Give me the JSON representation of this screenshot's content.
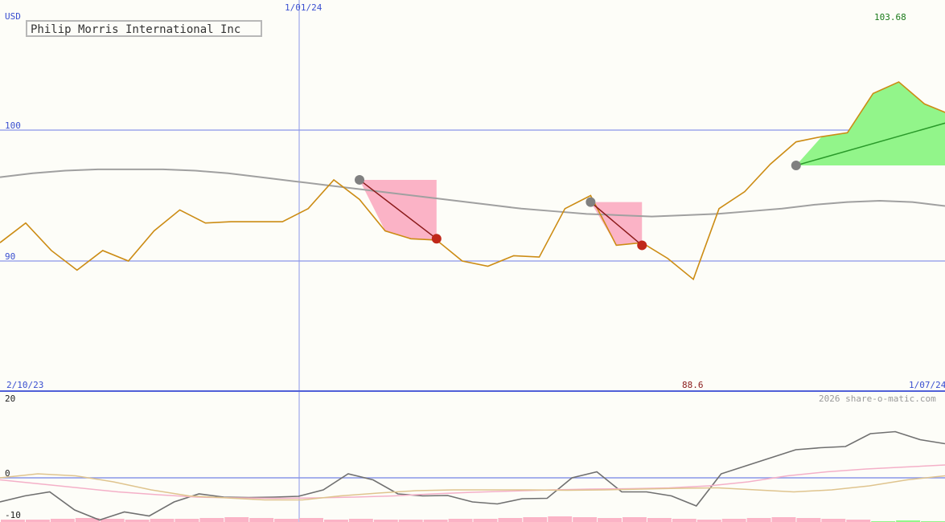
{
  "chart_data": [
    {
      "type": "line",
      "title": "Philip Morris International Inc",
      "currency_label": "USD",
      "y_ticks": [
        100,
        90
      ],
      "ylim": [
        80.3,
        109.6
      ],
      "x_date_labels": {
        "start": "2/10/23",
        "marker": "1/01/24",
        "end": "1/07/24"
      },
      "max_label": "103.68",
      "min_label": "88.6",
      "watermark": "2026 share-o-matic.com",
      "series": [
        {
          "values": [
            91.4,
            92.9,
            90.8,
            89.3,
            90.8,
            90.0,
            92.3,
            93.9,
            92.9,
            93.0,
            93.0,
            93.0,
            94.0,
            96.2,
            94.7,
            92.3,
            91.7,
            91.6,
            90.0,
            89.6,
            90.4,
            90.3,
            94.0,
            95.0,
            91.2,
            91.4,
            90.2,
            88.6,
            94.0,
            95.3,
            97.4,
            99.1,
            99.5,
            99.8,
            102.8,
            103.68,
            102.0,
            101.2
          ]
        },
        {
          "values": [
            96.4,
            96.7,
            96.9,
            97.0,
            97.0,
            97.0,
            96.9,
            96.7,
            96.4,
            96.1,
            95.8,
            95.5,
            95.2,
            94.9,
            94.6,
            94.3,
            94.0,
            93.8,
            93.6,
            93.5,
            93.4,
            93.5,
            93.6,
            93.8,
            94.0,
            94.3,
            94.5,
            94.6,
            94.5,
            94.2
          ]
        }
      ],
      "signals": [
        {
          "from_index": 14,
          "to_index": 17,
          "from_value": 96.2,
          "to_value": 91.7,
          "direction": "down"
        },
        {
          "from_index": 23,
          "to_index": 25,
          "from_value": 94.5,
          "to_value": 91.2,
          "direction": "down"
        },
        {
          "from_index": 31,
          "to_index": 38,
          "from_value": 97.3,
          "to_value": 101.2,
          "direction": "up"
        }
      ]
    },
    {
      "type": "line",
      "y_ticks": [
        20,
        0,
        -10
      ],
      "ylim": [
        -12,
        22
      ],
      "series": [
        {
          "values": [
            -6.0,
            -4.5,
            -3.5,
            -8.0,
            -10.5,
            -8.5,
            -9.5,
            -6.0,
            -4.0,
            -4.8,
            -4.9,
            -4.8,
            -4.6,
            -3.0,
            1.0,
            -0.5,
            -4.0,
            -4.5,
            -4.4,
            -6.0,
            -6.5,
            -5.2,
            -5.1,
            0.0,
            1.5,
            -3.5,
            -3.5,
            -4.5,
            -7.0,
            1.0,
            3.0,
            5.0,
            7.0,
            7.5,
            7.8,
            11.0,
            11.5,
            9.5,
            8.5
          ]
        },
        {
          "values": [
            -0.5,
            -1.5,
            -2.5,
            -3.5,
            -4.2,
            -4.8,
            -5.0,
            -5.1,
            -5.0,
            -4.8,
            -4.5,
            -4.0,
            -3.6,
            -3.3,
            -3.0,
            -2.8,
            -2.7,
            -2.5,
            -2.0,
            -1.0,
            0.5,
            1.5,
            2.2,
            2.7,
            3.2
          ]
        },
        {
          "values": [
            0.0,
            1.0,
            0.5,
            -1.0,
            -3.0,
            -4.5,
            -5.0,
            -5.5,
            -5.5,
            -4.5,
            -3.8,
            -3.2,
            -3.0,
            -3.0,
            -3.0,
            -3.1,
            -3.0,
            -2.8,
            -2.6,
            -2.5,
            -3.0,
            -3.5,
            -3.0,
            -2.0,
            -0.5,
            0.5
          ]
        }
      ],
      "bars": [
        -0.3,
        -0.3,
        -0.4,
        -0.5,
        -0.4,
        -0.3,
        -0.4,
        -0.4,
        -0.5,
        -0.6,
        -0.5,
        -0.4,
        -0.5,
        -0.3,
        -0.4,
        -0.3,
        -0.3,
        -0.3,
        -0.4,
        -0.4,
        -0.5,
        -0.6,
        -0.7,
        -0.6,
        -0.5,
        -0.6,
        -0.5,
        -0.4,
        -0.3,
        -0.4,
        -0.5,
        -0.6,
        -0.5,
        -0.4,
        -0.3,
        0.1,
        0.2,
        0.1
      ]
    }
  ],
  "colors": {
    "price": "#cc8c14",
    "moving_average": "#a0a0a0",
    "grid": "#8a96e8",
    "down_fill": "#fbb3c6",
    "up_fill": "#92f58a",
    "down_line": "#8b1a1a",
    "up_line": "#2a9a2a",
    "start_dot": "#808080",
    "end_dot": "#c0281a",
    "osc_main": "#707070",
    "osc_pink": "#f4b0c8",
    "osc_tan": "#dfc48e",
    "max_label": "#1a7a1a",
    "min_label": "#8a1a1a"
  }
}
